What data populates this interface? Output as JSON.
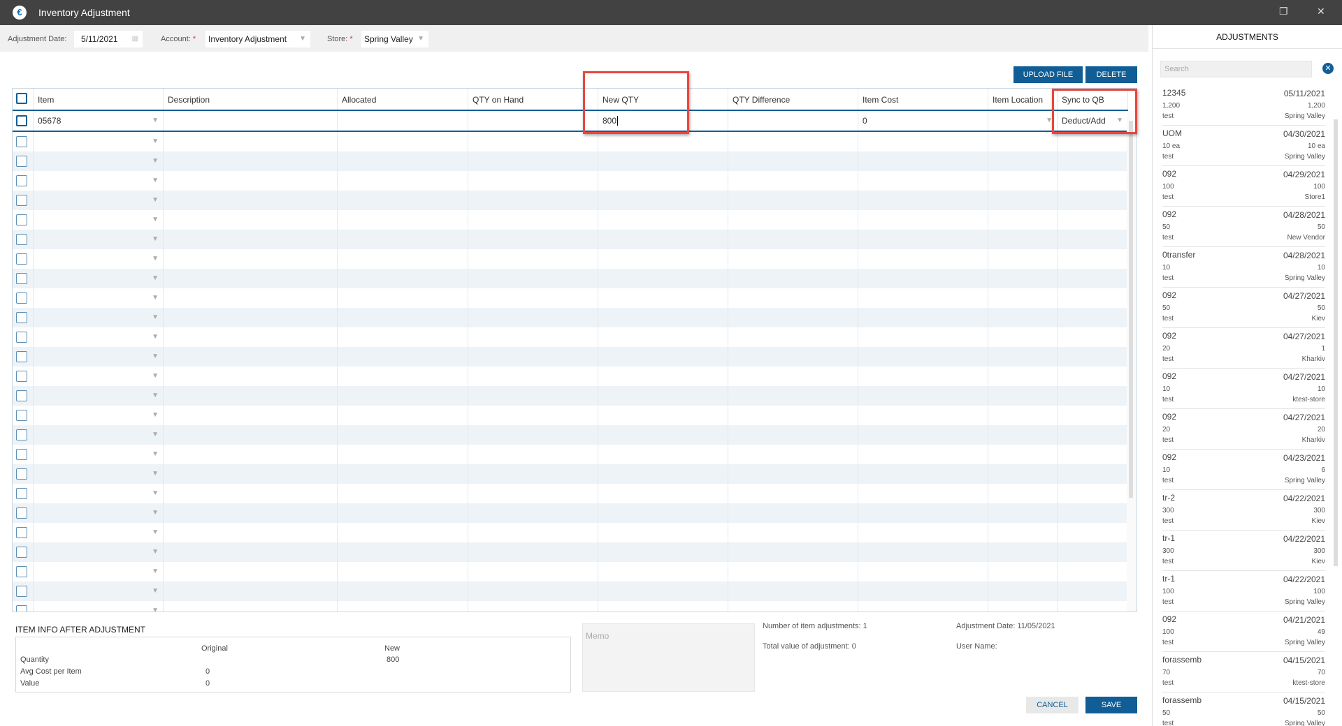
{
  "window": {
    "title": "Inventory Adjustment"
  },
  "toolbar": {
    "date_label": "Adjustment Date:",
    "date_value": "5/11/2021",
    "account_label": "Account:",
    "account_value": "Inventory Adjustment",
    "store_label": "Store:",
    "store_value": "Spring Valley",
    "required_mark": "*"
  },
  "actions": {
    "upload": "UPLOAD FILE",
    "delete": "DELETE",
    "cancel": "CANCEL",
    "save": "SAVE"
  },
  "table": {
    "columns": [
      "Item",
      "Description",
      "Allocated",
      "QTY on Hand",
      "New QTY",
      "QTY Difference",
      "Item Cost",
      "Item Location",
      "Sync to QB"
    ],
    "first_row": {
      "item": "05678",
      "new_qty": "800",
      "item_cost": "0",
      "sync": "Deduct/Add"
    }
  },
  "item_info": {
    "title": "ITEM INFO AFTER ADJUSTMENT",
    "col_original": "Original",
    "col_new": "New",
    "rows": [
      {
        "label": "Quantity",
        "original": "",
        "new": "800"
      },
      {
        "label": "Avg Cost per Item",
        "original": "0",
        "new": ""
      },
      {
        "label": "Value",
        "original": "0",
        "new": ""
      }
    ]
  },
  "memo": {
    "placeholder": "Memo"
  },
  "summary": {
    "num_adjustments": "Number of item adjustments: 1",
    "total_value": "Total value of adjustment: 0",
    "adj_date": "Adjustment Date: 11/05/2021",
    "user_name": "User Name:"
  },
  "sidebar": {
    "title": "ADJUSTMENTS",
    "search_placeholder": "Search",
    "items": [
      {
        "name": "12345",
        "date": "05/11/2021",
        "q1": "1,200",
        "q2": "1,200",
        "memo": "test",
        "store": "Spring Valley"
      },
      {
        "name": "UOM",
        "date": "04/30/2021",
        "q1": "10 ea",
        "q2": "10 ea",
        "memo": "test",
        "store": "Spring Valley"
      },
      {
        "name": "092",
        "date": "04/29/2021",
        "q1": "100",
        "q2": "100",
        "memo": "test",
        "store": "Store1"
      },
      {
        "name": "092",
        "date": "04/28/2021",
        "q1": "50",
        "q2": "50",
        "memo": "test",
        "store": "New Vendor"
      },
      {
        "name": "0transfer",
        "date": "04/28/2021",
        "q1": "10",
        "q2": "10",
        "memo": "test",
        "store": "Spring Valley"
      },
      {
        "name": "092",
        "date": "04/27/2021",
        "q1": "50",
        "q2": "50",
        "memo": "test",
        "store": "Kiev"
      },
      {
        "name": "092",
        "date": "04/27/2021",
        "q1": "20",
        "q2": "1",
        "memo": "test",
        "store": "Kharkiv"
      },
      {
        "name": "092",
        "date": "04/27/2021",
        "q1": "10",
        "q2": "10",
        "memo": "test",
        "store": "ktest-store"
      },
      {
        "name": "092",
        "date": "04/27/2021",
        "q1": "20",
        "q2": "20",
        "memo": "test",
        "store": "Kharkiv"
      },
      {
        "name": "092",
        "date": "04/23/2021",
        "q1": "10",
        "q2": "6",
        "memo": "test",
        "store": "Spring Valley"
      },
      {
        "name": "tr-2",
        "date": "04/22/2021",
        "q1": "300",
        "q2": "300",
        "memo": "test",
        "store": "Kiev"
      },
      {
        "name": "tr-1",
        "date": "04/22/2021",
        "q1": "300",
        "q2": "300",
        "memo": "test",
        "store": "Kiev"
      },
      {
        "name": "tr-1",
        "date": "04/22/2021",
        "q1": "100",
        "q2": "100",
        "memo": "test",
        "store": "Spring Valley"
      },
      {
        "name": "092",
        "date": "04/21/2021",
        "q1": "100",
        "q2": "49",
        "memo": "test",
        "store": "Spring Valley"
      },
      {
        "name": "forassemb",
        "date": "04/15/2021",
        "q1": "70",
        "q2": "70",
        "memo": "test",
        "store": "ktest-store"
      },
      {
        "name": "forassemb",
        "date": "04/15/2021",
        "q1": "50",
        "q2": "50",
        "memo": "test",
        "store": "Spring Valley"
      }
    ]
  }
}
